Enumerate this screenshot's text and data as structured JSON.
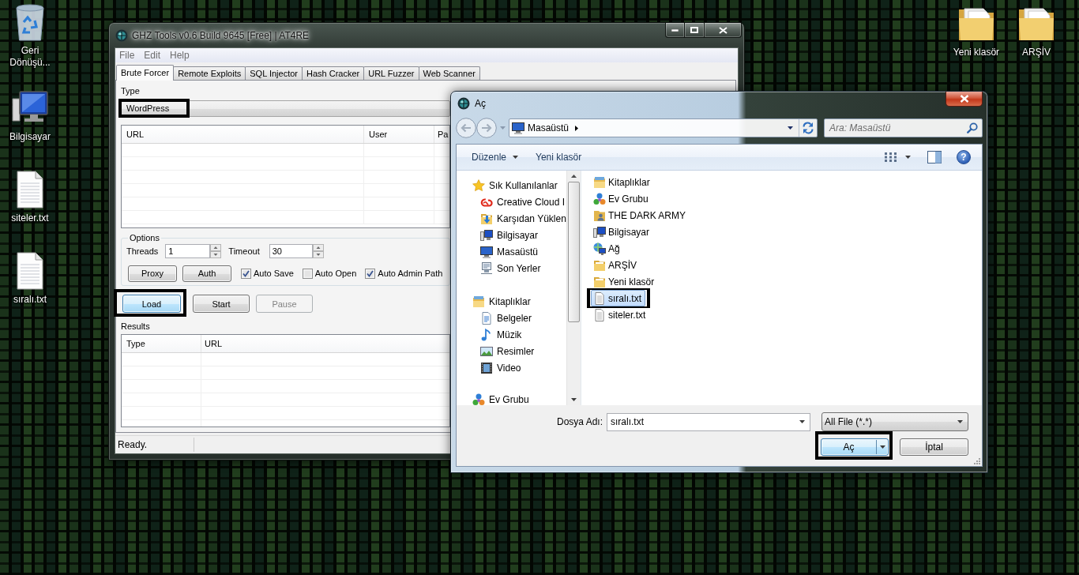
{
  "desktop": {
    "icons_left_column": [
      {
        "kind": "recycle-bin",
        "label": "Geri Dönüşü..."
      },
      {
        "kind": "computer",
        "label": "Bilgisayar"
      },
      {
        "kind": "text-file",
        "label": "siteler.txt"
      },
      {
        "kind": "text-file",
        "label": "sıralı.txt"
      }
    ],
    "icons_top_right": [
      {
        "kind": "folder",
        "label": "Yeni klasör"
      },
      {
        "kind": "folder",
        "label": "ARŞİV"
      }
    ]
  },
  "main_window": {
    "title": "GHZ Tools v0.6 Build 9645 [Free] | AT4RE",
    "menu": [
      "File",
      "Edit",
      "Help"
    ],
    "tabs": [
      {
        "label": "Brute Forcer",
        "selected": true
      },
      {
        "label": "Remote Exploits",
        "selected": false
      },
      {
        "label": "SQL Injector",
        "selected": false
      },
      {
        "label": "Hash Cracker",
        "selected": false
      },
      {
        "label": "URL Fuzzer",
        "selected": false
      },
      {
        "label": "Web Scanner",
        "selected": false
      }
    ],
    "type_label": "Type",
    "type_select": {
      "value": "WordPress",
      "marked": true
    },
    "targets_table": {
      "columns": [
        "URL",
        "User",
        "Pa"
      ]
    },
    "options": {
      "title": "Options",
      "fields": [
        {
          "label": "Threads",
          "value": "1"
        },
        {
          "label": "Timeout",
          "value": "30"
        }
      ],
      "buttons": [
        "Proxy",
        "Auth"
      ],
      "checkboxes": [
        {
          "label": "Auto Save",
          "checked": true
        },
        {
          "label": "Auto Open",
          "checked": false
        },
        {
          "label": "Auto Admin Path",
          "checked": true
        }
      ]
    },
    "actions": [
      {
        "label": "Load",
        "focused": true,
        "disabled": false,
        "marked": true
      },
      {
        "label": "Start",
        "focused": false,
        "disabled": false,
        "marked": false
      },
      {
        "label": "Pause",
        "focused": false,
        "disabled": true,
        "marked": false
      }
    ],
    "results_label": "Results",
    "results_table": {
      "columns": [
        "Type",
        "URL"
      ]
    },
    "status_bar": "Ready."
  },
  "open_dialog": {
    "title": "Aç",
    "address": [
      "Masaüstü"
    ],
    "search": {
      "placeholder": "Ara: Masaüstü"
    },
    "toolbar": [
      {
        "label": "Düzenle",
        "kind": "menu"
      },
      {
        "label": "Yeni klasör",
        "kind": "command"
      }
    ],
    "help_button": "?",
    "navigation": [
      {
        "label": "Sık Kullanılanlar",
        "kind": "favorites",
        "children": [
          {
            "label": "Creative Cloud I",
            "kind": "creative-cloud"
          },
          {
            "label": "Karşıdan Yüklen",
            "kind": "downloads"
          },
          {
            "label": "Bilgisayar",
            "kind": "computer"
          },
          {
            "label": "Masaüstü",
            "kind": "desktop"
          },
          {
            "label": "Son Yerler",
            "kind": "recent"
          }
        ]
      },
      {
        "label": "Kitaplıklar",
        "kind": "libraries",
        "children": [
          {
            "label": "Belgeler",
            "kind": "documents"
          },
          {
            "label": "Müzik",
            "kind": "music"
          },
          {
            "label": "Resimler",
            "kind": "pictures"
          },
          {
            "label": "Video",
            "kind": "video"
          }
        ]
      },
      {
        "label": "Ev Grubu",
        "kind": "homegroup"
      }
    ],
    "files": [
      {
        "label": "Kitaplıklar",
        "kind": "libraries",
        "selected": false,
        "marked": false
      },
      {
        "label": "Ev Grubu",
        "kind": "homegroup",
        "selected": false,
        "marked": false
      },
      {
        "label": "THE DARK ARMY",
        "kind": "user-folder",
        "selected": false,
        "marked": false
      },
      {
        "label": "Bilgisayar",
        "kind": "computer",
        "selected": false,
        "marked": false
      },
      {
        "label": "Ağ",
        "kind": "network",
        "selected": false,
        "marked": false
      },
      {
        "label": "ARŞİV",
        "kind": "folder",
        "selected": false,
        "marked": false
      },
      {
        "label": "Yeni klasör",
        "kind": "folder",
        "selected": false,
        "marked": false
      },
      {
        "label": "sıralı.txt",
        "kind": "text-file",
        "selected": true,
        "marked": true
      },
      {
        "label": "siteler.txt",
        "kind": "text-file",
        "selected": false,
        "marked": false
      }
    ],
    "file_name_label": "Dosya Adı:",
    "file_name": "sıralı.txt",
    "file_type": "All File (*.*)",
    "buttons": [
      {
        "label": "Aç",
        "kind": "split",
        "default": true,
        "marked": true
      },
      {
        "label": "İptal",
        "kind": "plain",
        "default": false,
        "marked": false
      }
    ]
  }
}
